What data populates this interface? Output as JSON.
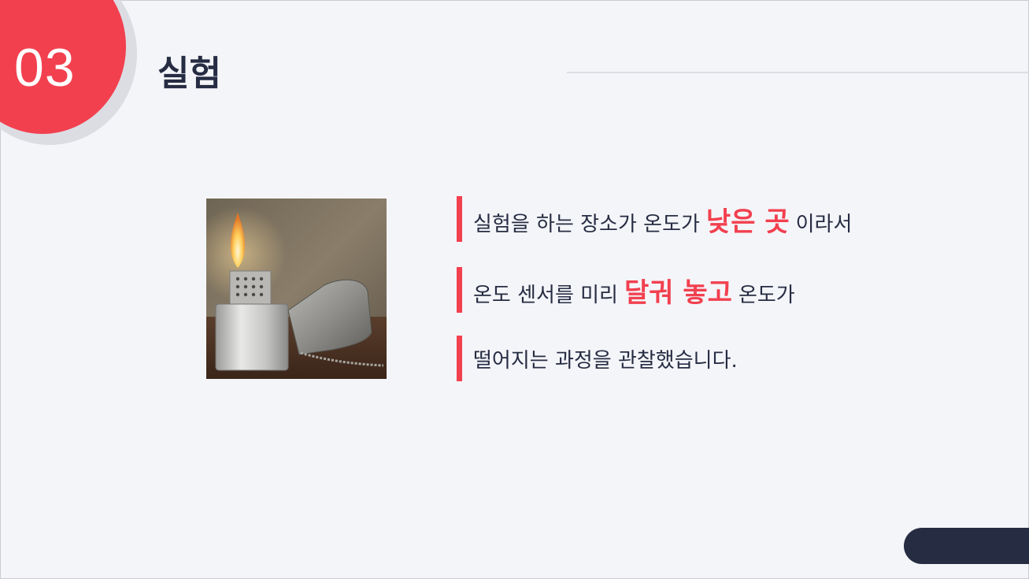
{
  "slide": {
    "number": "03",
    "title": "실험"
  },
  "image": {
    "subject": "zippo-lighter-photo"
  },
  "bullets": [
    {
      "before": "실험을 하는 장소가 온도가",
      "highlight": "낮은 곳",
      "after": "이라서"
    },
    {
      "before": "온도 센서를 미리",
      "highlight": "달궈 놓고",
      "after": "온도가"
    },
    {
      "before": "떨어지는 과정을 관찰했습니다.",
      "highlight": "",
      "after": ""
    }
  ],
  "colors": {
    "accent": "#f2404f",
    "navy": "#262c42",
    "background": "#f4f5f9"
  }
}
